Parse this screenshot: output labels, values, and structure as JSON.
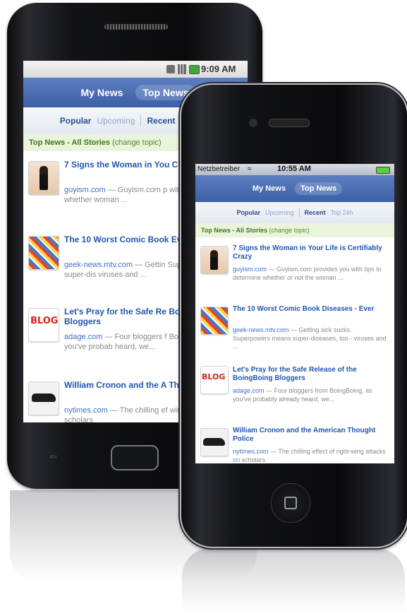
{
  "android": {
    "status_time": "9:09 AM"
  },
  "iphone": {
    "carrier": "Netzbetreiber",
    "status_time": "10:55 AM"
  },
  "nav": {
    "my_news": "My News",
    "top_news": "Top News"
  },
  "filters": {
    "popular": "Popular",
    "upcoming": "Upcoming",
    "recent": "Recent",
    "top24h": "Top 24h"
  },
  "topic": {
    "label": "Top News - All Stories",
    "change": "(change topic)"
  },
  "android_stories": [
    {
      "title": "7 Signs the Woman in You Certifiably Crazy",
      "source": "guyism.com",
      "snippet": " — Guyism.com p with tips to determine whether woman ..."
    },
    {
      "title": "The 10 Worst Comic Book Ever",
      "source": "geek-news.mtv.com",
      "snippet": " — Gettin Superpowers means super-dis viruses and ..."
    },
    {
      "title": "Let's Pray for the Safe Re BoingBoing Bloggers",
      "source": "adage.com",
      "snippet": " — Four bloggers f BoingBoing, as you've probab heard, we..."
    },
    {
      "title": "William Cronon and the A Thought Police",
      "source": "nytimes.com",
      "snippet": " — The chilling ef wing attacks on scholars"
    }
  ],
  "iphone_stories": [
    {
      "title": "7 Signs the Woman in Your Life is Certifiably Crazy",
      "source": "guyism.com",
      "snippet": " — Guyism.com provides you with tips to determine whether or not the woman ..."
    },
    {
      "title": "The 10 Worst Comic Book Diseases - Ever",
      "source": "geek-news.mtv.com",
      "snippet": " — Getting sick sucks. Superpowers means super-diseases, too - viruses and ..."
    },
    {
      "title": "Let's Pray for the Safe Release of the BoingBoing Bloggers",
      "source": "adage.com",
      "snippet": " — Four bloggers from BoingBoing, as you've probably already heard, we..."
    },
    {
      "title": "William Cronon and the American Thought Police",
      "source": "nytimes.com",
      "snippet": " — The chilling effect of right-wing attacks on scholars"
    }
  ],
  "thumbs": {
    "blog_label": "BLOG"
  }
}
